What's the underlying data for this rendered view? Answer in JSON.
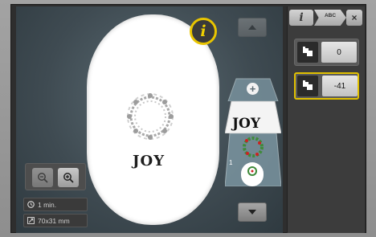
{
  "info_button": {
    "label": "i"
  },
  "tabs": [
    {
      "label": "i",
      "icon": "info-tab-icon"
    },
    {
      "label": "ABC",
      "icon": "lettering-tab-icon"
    }
  ],
  "close_button": {
    "label": "×"
  },
  "design": {
    "text": "JOY"
  },
  "layers": {
    "add_label": "+",
    "layer1_text": "JOY",
    "layer2_number": "1"
  },
  "scroll": {
    "up_icon": "chevron-up-icon",
    "down_icon": "chevron-down-icon"
  },
  "zoom": {
    "out_icon": "zoom-out-icon",
    "in_icon": "zoom-in-icon"
  },
  "stats": {
    "time": "1 min.",
    "size": "70x31 mm"
  },
  "controls": [
    {
      "icon": "hand-adjust-icon",
      "value": "0"
    },
    {
      "icon": "hand-rotate-icon",
      "value": "-41",
      "selected": true
    }
  ],
  "colors": {
    "accent": "#e8c400",
    "hoop": "#ffffff",
    "background": "#4a5960"
  }
}
